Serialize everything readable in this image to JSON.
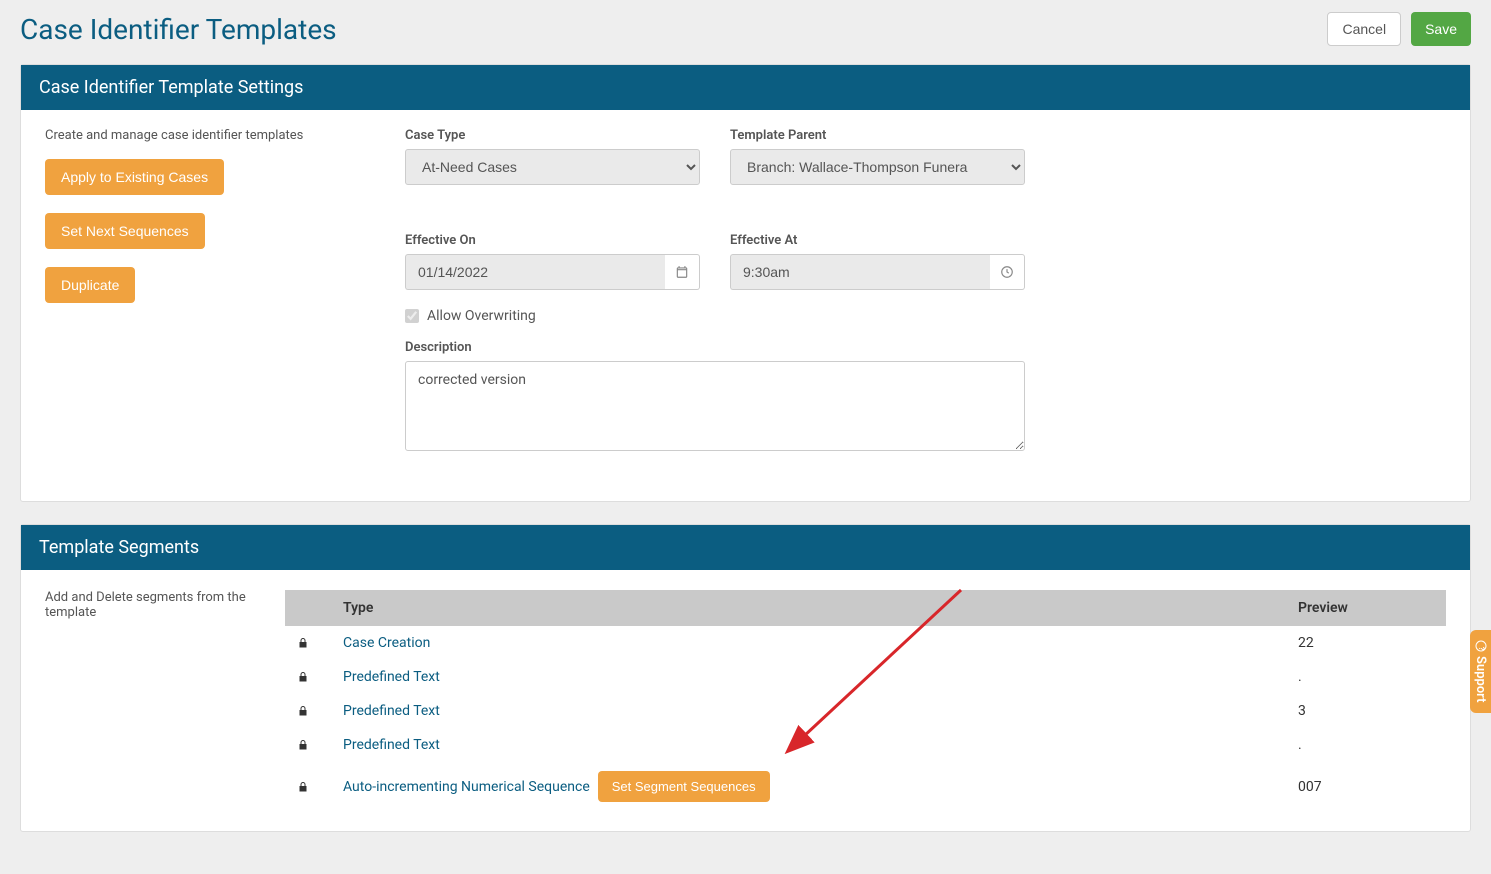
{
  "page": {
    "title": "Case Identifier Templates",
    "cancel": "Cancel",
    "save": "Save"
  },
  "settings": {
    "panel_title": "Case Identifier Template Settings",
    "helper": "Create and manage case identifier templates",
    "apply_btn": "Apply to Existing Cases",
    "sequences_btn": "Set Next Sequences",
    "duplicate_btn": "Duplicate",
    "case_type_label": "Case Type",
    "case_type_value": "At-Need Cases",
    "template_parent_label": "Template Parent",
    "template_parent_value": "Branch: Wallace-Thompson Funera",
    "effective_on_label": "Effective On",
    "effective_on_value": "01/14/2022",
    "effective_at_label": "Effective At",
    "effective_at_value": "9:30am",
    "allow_overwriting_label": "Allow Overwriting",
    "description_label": "Description",
    "description_value": "corrected version"
  },
  "segments": {
    "panel_title": "Template Segments",
    "helper": "Add and Delete segments from the template",
    "col_type": "Type",
    "col_preview": "Preview",
    "set_seq_btn": "Set Segment Sequences",
    "rows": [
      {
        "type": "Case Creation",
        "preview": "22",
        "action": false
      },
      {
        "type": "Predefined Text",
        "preview": ".",
        "action": false
      },
      {
        "type": "Predefined Text",
        "preview": "3",
        "action": false
      },
      {
        "type": "Predefined Text",
        "preview": ".",
        "action": false
      },
      {
        "type": "Auto-incrementing Numerical Sequence",
        "preview": "007",
        "action": true
      }
    ]
  },
  "support": {
    "label": "Support"
  }
}
